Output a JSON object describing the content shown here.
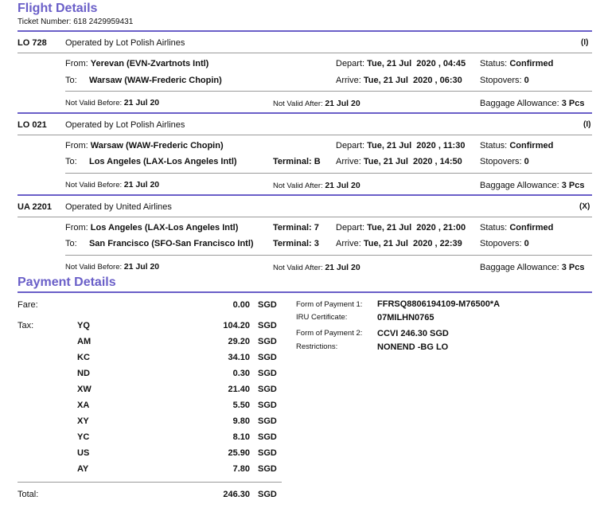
{
  "flight_details": {
    "title": "Flight Details",
    "ticket_label": "Ticket Number:",
    "ticket_number": "618 2429959431"
  },
  "segments": [
    {
      "flight": "LO 728",
      "operated_by": "Operated by Lot Polish Airlines",
      "mark": "(I)",
      "from_label": "From:",
      "from": "Yerevan (EVN-Zvartnots Intl)",
      "from_terminal_label": "",
      "from_terminal": "",
      "to_label": "To:",
      "to": "Warsaw (WAW-Frederic Chopin)",
      "to_terminal_label": "",
      "to_terminal": "",
      "depart_label": "Depart:",
      "depart": "Tue, 21 Jul  2020 , 04:45",
      "arrive_label": "Arrive:",
      "arrive": "Tue, 21 Jul  2020 , 06:30",
      "status_label": "Status:",
      "status": "Confirmed",
      "stopovers_label": "Stopovers:",
      "stopovers": "0",
      "nvb_label": "Not Valid Before:",
      "nvb": "21 Jul 20",
      "nva_label": "Not Valid After:",
      "nva": "21 Jul 20",
      "baggage_label": "Baggage Allowance:",
      "baggage": "3 Pcs"
    },
    {
      "flight": "LO 021",
      "operated_by": "Operated by Lot Polish Airlines",
      "mark": "(I)",
      "from_label": "From:",
      "from": "Warsaw (WAW-Frederic Chopin)",
      "from_terminal_label": "",
      "from_terminal": "",
      "to_label": "To:",
      "to": "Los Angeles (LAX-Los Angeles Intl)",
      "to_terminal_label": "Terminal:",
      "to_terminal": "B",
      "depart_label": "Depart:",
      "depart": "Tue, 21 Jul  2020 , 11:30",
      "arrive_label": "Arrive:",
      "arrive": "Tue, 21 Jul  2020 , 14:50",
      "status_label": "Status:",
      "status": "Confirmed",
      "stopovers_label": "Stopovers:",
      "stopovers": "0",
      "nvb_label": "Not Valid Before:",
      "nvb": "21 Jul 20",
      "nva_label": "Not Valid After:",
      "nva": "21 Jul 20",
      "baggage_label": "Baggage Allowance:",
      "baggage": "3 Pcs"
    },
    {
      "flight": "UA 2201",
      "operated_by": "Operated by United Airlines",
      "mark": "(X)",
      "from_label": "From:",
      "from": "Los Angeles (LAX-Los Angeles Intl)",
      "from_terminal_label": "Terminal:",
      "from_terminal": "7",
      "to_label": "To:",
      "to": "San Francisco (SFO-San Francisco Intl)",
      "to_terminal_label": "Terminal:",
      "to_terminal": "3",
      "depart_label": "Depart:",
      "depart": "Tue, 21 Jul  2020 , 21:00",
      "arrive_label": "Arrive:",
      "arrive": "Tue, 21 Jul  2020 , 22:39",
      "status_label": "Status:",
      "status": "Confirmed",
      "stopovers_label": "Stopovers:",
      "stopovers": "0",
      "nvb_label": "Not Valid Before:",
      "nvb": "21 Jul 20",
      "nva_label": "Not Valid After:",
      "nva": "21 Jul 20",
      "baggage_label": "Baggage Allowance:",
      "baggage": "3 Pcs"
    }
  ],
  "payment": {
    "title": "Payment Details",
    "fare_label": "Fare:",
    "fare_amount": "0.00",
    "fare_currency": "SGD",
    "tax_label": "Tax:",
    "taxes": [
      {
        "code": "YQ",
        "amount": "104.20",
        "currency": "SGD"
      },
      {
        "code": "AM",
        "amount": "29.20",
        "currency": "SGD"
      },
      {
        "code": "KC",
        "amount": "34.10",
        "currency": "SGD"
      },
      {
        "code": "ND",
        "amount": "0.30",
        "currency": "SGD"
      },
      {
        "code": "XW",
        "amount": "21.40",
        "currency": "SGD"
      },
      {
        "code": "XA",
        "amount": "5.50",
        "currency": "SGD"
      },
      {
        "code": "XY",
        "amount": "9.80",
        "currency": "SGD"
      },
      {
        "code": "YC",
        "amount": "8.10",
        "currency": "SGD"
      },
      {
        "code": "US",
        "amount": "25.90",
        "currency": "SGD"
      },
      {
        "code": "AY",
        "amount": "7.80",
        "currency": "SGD"
      }
    ],
    "total_label": "Total:",
    "total_amount": "246.30",
    "total_currency": "SGD",
    "fop1_label": "Form of Payment 1:",
    "fop1": "FFRSQ8806194109-M76500*A",
    "iru_label": "IRU Certificate:",
    "iru": "07MILHN0765",
    "fop2_label": "Form of Payment 2:",
    "fop2": "CCVI 246.30 SGD",
    "restrictions_label": "Restrictions:",
    "restrictions": "NONEND -BG LO"
  },
  "colors": {
    "accent": "#6a5fc8",
    "rule": "#9a9a9a"
  }
}
